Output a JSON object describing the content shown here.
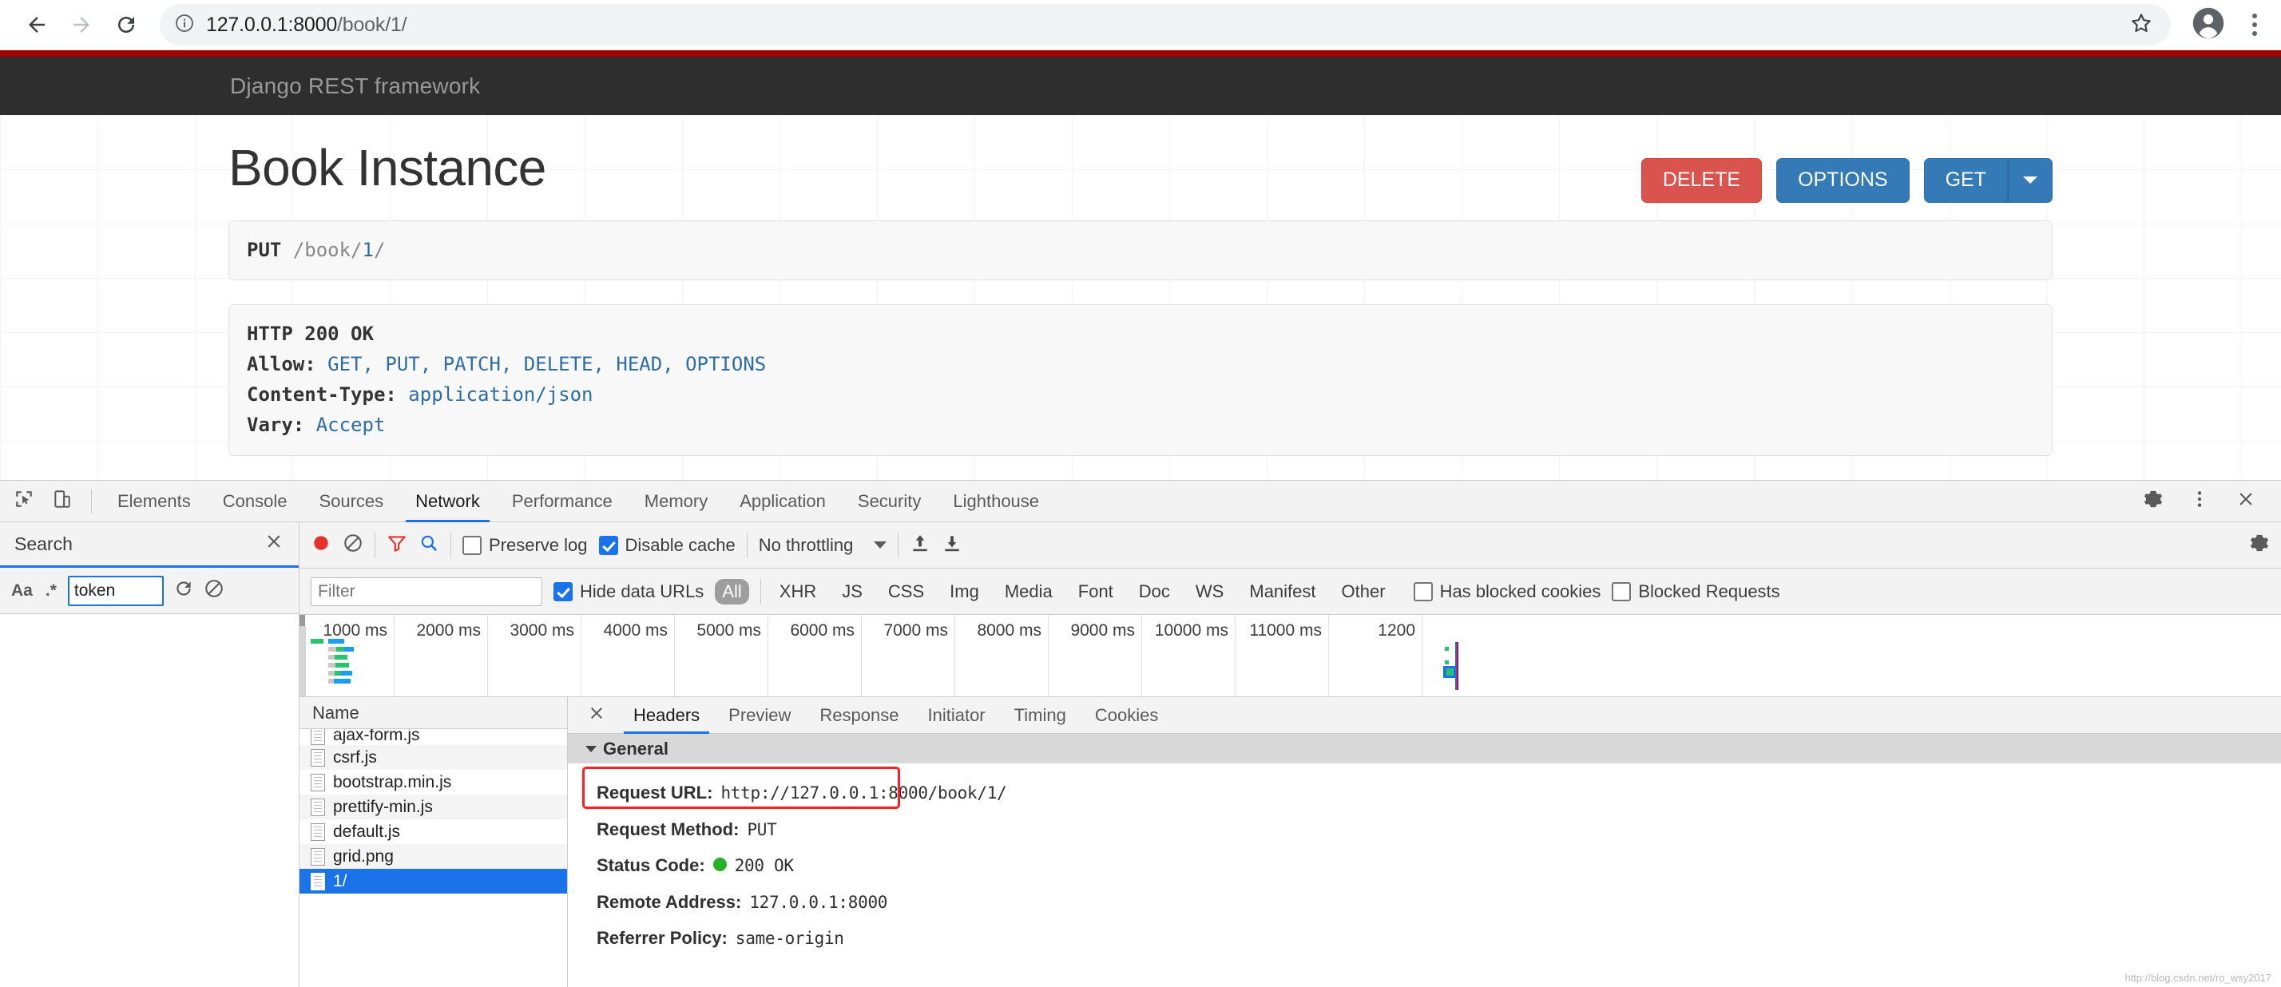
{
  "browser": {
    "back_icon": "arrow-left-icon",
    "forward_icon": "arrow-right-icon",
    "reload_icon": "reload-icon",
    "info_icon": "info-circle-icon",
    "url_prefix": "127.0.0.1:8000",
    "url_path": "/book/1/",
    "star_icon": "star-icon",
    "profile_icon": "profile-avatar-icon",
    "menu_icon": "three-dot-menu-icon"
  },
  "drf": {
    "brand": "Django REST framework",
    "page_title": "Book Instance",
    "buttons": {
      "delete": "DELETE",
      "options": "OPTIONS",
      "get": "GET"
    },
    "request_line": {
      "method": "PUT",
      "path_prefix": "/book/",
      "path_id": "1",
      "path_suffix": "/"
    },
    "response": {
      "status_line": "HTTP 200 OK",
      "headers": [
        {
          "key": "Allow:",
          "value": "GET, PUT, PATCH, DELETE, HEAD, OPTIONS"
        },
        {
          "key": "Content-Type:",
          "value": "application/json"
        },
        {
          "key": "Vary:",
          "value": "Accept"
        }
      ]
    }
  },
  "devtools": {
    "inspect_icon": "inspect-element-icon",
    "device_icon": "device-toolbar-icon",
    "tabs": [
      {
        "label": "Elements",
        "active": false
      },
      {
        "label": "Console",
        "active": false
      },
      {
        "label": "Sources",
        "active": false
      },
      {
        "label": "Network",
        "active": true
      },
      {
        "label": "Performance",
        "active": false
      },
      {
        "label": "Memory",
        "active": false
      },
      {
        "label": "Application",
        "active": false
      },
      {
        "label": "Security",
        "active": false
      },
      {
        "label": "Lighthouse",
        "active": false
      }
    ],
    "settings_icon": "gear-icon",
    "more_icon": "three-dot-vertical-icon",
    "close_icon": "close-icon",
    "search": {
      "title": "Search",
      "close_icon": "close-icon",
      "match_case_label": "Aa",
      "regex_label": ".*",
      "query": "token",
      "refresh_icon": "refresh-icon",
      "clear_icon": "clear-icon"
    },
    "network_toolbar": {
      "record_icon": "record-button-icon",
      "clear_icon": "clear-network-icon",
      "filter_icon": "filter-funnel-icon",
      "search_icon": "search-magnifier-icon",
      "preserve_log": {
        "label": "Preserve log",
        "checked": false
      },
      "disable_cache": {
        "label": "Disable cache",
        "checked": true
      },
      "throttling": "No throttling",
      "import_icon": "upload-har-icon",
      "export_icon": "download-har-icon",
      "settings_icon": "gear-icon"
    },
    "filter_bar": {
      "filter_placeholder": "Filter",
      "filter_value": "",
      "hide_data_urls": {
        "label": "Hide data URLs",
        "checked": true
      },
      "types": [
        "All",
        "XHR",
        "JS",
        "CSS",
        "Img",
        "Media",
        "Font",
        "Doc",
        "WS",
        "Manifest",
        "Other"
      ],
      "active_type": "All",
      "has_blocked_cookies": {
        "label": "Has blocked cookies",
        "checked": false
      },
      "blocked_requests": {
        "label": "Blocked Requests",
        "checked": false
      }
    },
    "timeline": {
      "ticks": [
        "1000 ms",
        "2000 ms",
        "3000 ms",
        "4000 ms",
        "5000 ms",
        "6000 ms",
        "7000 ms",
        "8000 ms",
        "9000 ms",
        "10000 ms",
        "11000 ms",
        "1200"
      ]
    },
    "request_list": {
      "column_header": "Name",
      "rows": [
        {
          "name": "ajax-form.js",
          "selected": false
        },
        {
          "name": "csrf.js",
          "selected": false
        },
        {
          "name": "bootstrap.min.js",
          "selected": false
        },
        {
          "name": "prettify-min.js",
          "selected": false
        },
        {
          "name": "default.js",
          "selected": false
        },
        {
          "name": "grid.png",
          "selected": false
        },
        {
          "name": "1/",
          "selected": true
        }
      ]
    },
    "detail": {
      "close_icon": "close-icon",
      "tabs": [
        {
          "label": "Headers",
          "active": true
        },
        {
          "label": "Preview",
          "active": false
        },
        {
          "label": "Response",
          "active": false
        },
        {
          "label": "Initiator",
          "active": false
        },
        {
          "label": "Timing",
          "active": false
        },
        {
          "label": "Cookies",
          "active": false
        }
      ],
      "section_title": "General",
      "general": [
        {
          "key": "Request URL:",
          "value": "http://127.0.0.1:8000/book/1/",
          "highlighted": true
        },
        {
          "key": "Request Method:",
          "value": "PUT",
          "highlighted": true
        },
        {
          "key": "Status Code:",
          "value": "200 OK",
          "dot": true
        },
        {
          "key": "Remote Address:",
          "value": "127.0.0.1:8000"
        },
        {
          "key": "Referrer Policy:",
          "value": "same-origin"
        }
      ],
      "status_tooltip": "http://blog.csdn.net/ro_wsy2017"
    }
  },
  "colors": {
    "drf_accent": "#a30000",
    "drf_navbar": "#2e2e2e",
    "btn_danger": "#d9534f",
    "btn_primary": "#337ab7",
    "devtools_blue": "#1a73e8",
    "highlight_red": "#ff2020",
    "status_green": "#29b029"
  }
}
